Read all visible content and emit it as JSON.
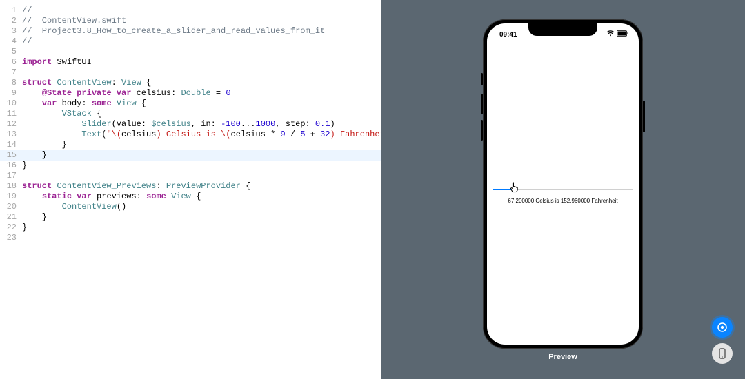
{
  "editor": {
    "highlighted_line": 15,
    "lines": [
      {
        "n": 1,
        "t": [
          [
            "comment",
            "//"
          ]
        ]
      },
      {
        "n": 2,
        "t": [
          [
            "comment",
            "//  ContentView.swift"
          ]
        ]
      },
      {
        "n": 3,
        "t": [
          [
            "comment",
            "//  Project3.8_How_to_create_a_slider_and_read_values_from_it"
          ]
        ]
      },
      {
        "n": 4,
        "t": [
          [
            "comment",
            "//"
          ]
        ]
      },
      {
        "n": 5,
        "t": []
      },
      {
        "n": 6,
        "t": [
          [
            "keyword",
            "import"
          ],
          [
            "plain",
            " SwiftUI"
          ]
        ]
      },
      {
        "n": 7,
        "t": []
      },
      {
        "n": 8,
        "t": [
          [
            "keyword",
            "struct"
          ],
          [
            "plain",
            " "
          ],
          [
            "type",
            "ContentView"
          ],
          [
            "plain",
            ": "
          ],
          [
            "type",
            "View"
          ],
          [
            "plain",
            " {"
          ]
        ]
      },
      {
        "n": 9,
        "t": [
          [
            "plain",
            "    "
          ],
          [
            "keyword",
            "@State"
          ],
          [
            "plain",
            " "
          ],
          [
            "keyword",
            "private"
          ],
          [
            "plain",
            " "
          ],
          [
            "keyword",
            "var"
          ],
          [
            "plain",
            " celsius: "
          ],
          [
            "type",
            "Double"
          ],
          [
            "plain",
            " = "
          ],
          [
            "number",
            "0"
          ]
        ]
      },
      {
        "n": 10,
        "t": [
          [
            "plain",
            "    "
          ],
          [
            "keyword",
            "var"
          ],
          [
            "plain",
            " body: "
          ],
          [
            "keyword",
            "some"
          ],
          [
            "plain",
            " "
          ],
          [
            "type",
            "View"
          ],
          [
            "plain",
            " {"
          ]
        ]
      },
      {
        "n": 11,
        "t": [
          [
            "plain",
            "        "
          ],
          [
            "type",
            "VStack"
          ],
          [
            "plain",
            " {"
          ]
        ]
      },
      {
        "n": 12,
        "t": [
          [
            "plain",
            "            "
          ],
          [
            "type",
            "Slider"
          ],
          [
            "plain",
            "(value: "
          ],
          [
            "property",
            "$celsius"
          ],
          [
            "plain",
            ", in: "
          ],
          [
            "number",
            "-100"
          ],
          [
            "plain",
            "..."
          ],
          [
            "number",
            "1000"
          ],
          [
            "plain",
            ", step: "
          ],
          [
            "number",
            "0.1"
          ],
          [
            "plain",
            ")"
          ]
        ]
      },
      {
        "n": 13,
        "t": [
          [
            "plain",
            "            "
          ],
          [
            "type",
            "Text"
          ],
          [
            "plain",
            "("
          ],
          [
            "string",
            "\"\\("
          ],
          [
            "interp",
            "celsius"
          ],
          [
            "string",
            ") Celsius is \\("
          ],
          [
            "interp",
            "celsius "
          ],
          [
            "plain",
            "*"
          ],
          [
            "interp",
            " "
          ],
          [
            "number",
            "9"
          ],
          [
            "interp",
            " "
          ],
          [
            "plain",
            "/"
          ],
          [
            "interp",
            " "
          ],
          [
            "number",
            "5"
          ],
          [
            "interp",
            " "
          ],
          [
            "plain",
            "+"
          ],
          [
            "interp",
            " "
          ],
          [
            "number",
            "32"
          ],
          [
            "string",
            ") Fahrenheit\""
          ],
          [
            "plain",
            ")"
          ]
        ]
      },
      {
        "n": 14,
        "t": [
          [
            "plain",
            "        }"
          ]
        ]
      },
      {
        "n": 15,
        "t": [
          [
            "plain",
            "    }"
          ]
        ]
      },
      {
        "n": 16,
        "t": [
          [
            "plain",
            "}"
          ]
        ]
      },
      {
        "n": 17,
        "t": []
      },
      {
        "n": 18,
        "t": [
          [
            "keyword",
            "struct"
          ],
          [
            "plain",
            " "
          ],
          [
            "type",
            "ContentView_Previews"
          ],
          [
            "plain",
            ": "
          ],
          [
            "type",
            "PreviewProvider"
          ],
          [
            "plain",
            " {"
          ]
        ]
      },
      {
        "n": 19,
        "t": [
          [
            "plain",
            "    "
          ],
          [
            "keyword",
            "static"
          ],
          [
            "plain",
            " "
          ],
          [
            "keyword",
            "var"
          ],
          [
            "plain",
            " previews: "
          ],
          [
            "keyword",
            "some"
          ],
          [
            "plain",
            " "
          ],
          [
            "type",
            "View"
          ],
          [
            "plain",
            " {"
          ]
        ]
      },
      {
        "n": 20,
        "t": [
          [
            "plain",
            "        "
          ],
          [
            "type",
            "ContentView"
          ],
          [
            "plain",
            "()"
          ]
        ]
      },
      {
        "n": 21,
        "t": [
          [
            "plain",
            "    }"
          ]
        ]
      },
      {
        "n": 22,
        "t": [
          [
            "plain",
            "}"
          ]
        ]
      },
      {
        "n": 23,
        "t": []
      }
    ]
  },
  "preview": {
    "label": "Preview",
    "status_time": "09:41",
    "temperature_text": "67.200000 Celsius is 152.960000 Fahrenheit",
    "slider_fill_percent": 15.2
  }
}
